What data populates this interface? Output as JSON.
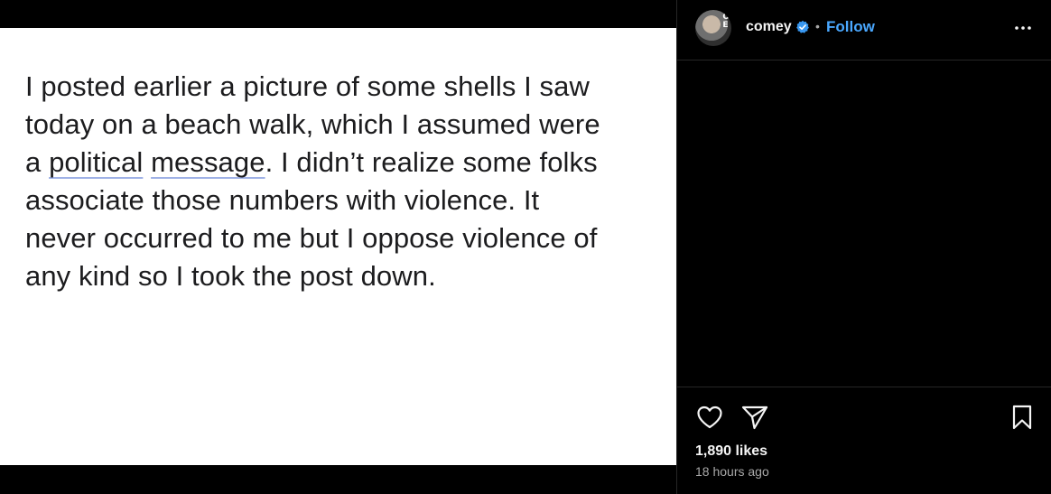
{
  "post": {
    "text_lines": [
      "I posted earlier a picture of some shells I saw",
      "today on a beach walk, which I assumed were",
      "a ",
      "political",
      " ",
      "message",
      ". I didn’t realize some folks",
      "associate those numbers with violence. It",
      "never occurred to me but I oppose violence of",
      "any kind so I took the post down."
    ]
  },
  "header": {
    "username": "comey",
    "avatar_letters": "O\nE",
    "separator": "•",
    "follow_label": "Follow",
    "verified_icon": "verified-badge-icon",
    "verified_color": "#3897f0"
  },
  "actions": {
    "like_icon": "heart-icon",
    "share_icon": "paper-plane-icon",
    "save_icon": "bookmark-icon",
    "likes": "1,890 likes",
    "timestamp": "18 hours ago"
  },
  "colors": {
    "background": "#000000",
    "link": "#4aa8ff",
    "text_primary": "#f5f5f5",
    "text_secondary": "#a8a8a8"
  }
}
